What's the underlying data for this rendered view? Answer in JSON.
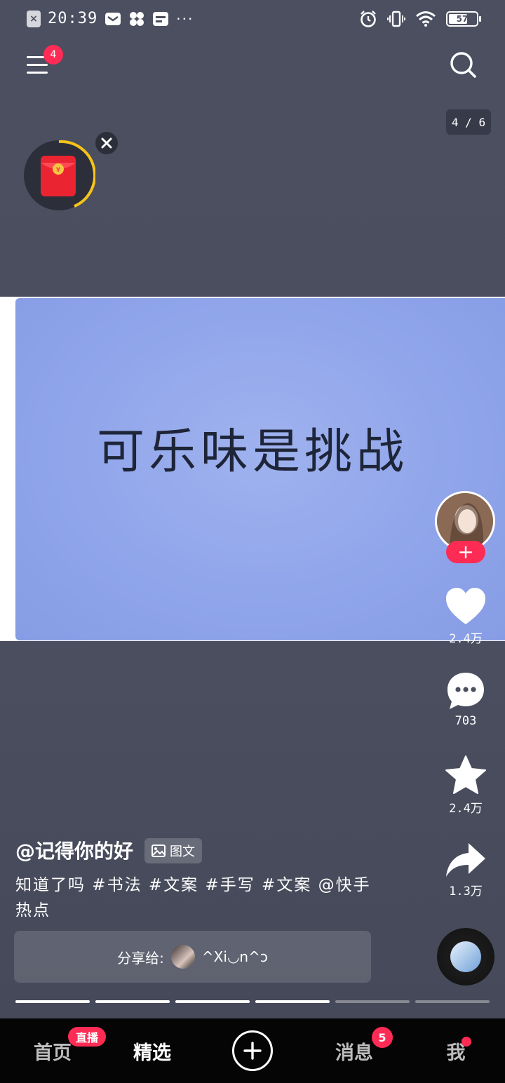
{
  "status_bar": {
    "time": "20:39",
    "notification_icons": [
      "close-box-icon",
      "mail-icon",
      "pinwheel-icon",
      "wallet-icon"
    ],
    "more": "···",
    "battery": "57"
  },
  "header": {
    "menu_badge": "4",
    "page_counter": "4 / 6"
  },
  "post": {
    "image_text": "可乐味是挑战",
    "author": "@记得你的好",
    "type_tag": "图文",
    "caption": "知道了吗 #书法 #文案 #手写 #文案 @快手热点",
    "share_label": "分享给:",
    "share_user": "^Xi◡n^ɔ",
    "progress": {
      "total": 6,
      "current": 4
    }
  },
  "actions": {
    "likes": "2.4万",
    "comments": "703",
    "favorites": "2.4万",
    "shares": "1.3万"
  },
  "nav": {
    "home": "首页",
    "home_badge": "直播",
    "featured": "精选",
    "messages": "消息",
    "messages_badge": "5",
    "me": "我"
  },
  "colors": {
    "accent": "#fe2c55",
    "background": "#4a4e5e",
    "paper": "#93a8eb",
    "nav_bg": "#050505"
  }
}
